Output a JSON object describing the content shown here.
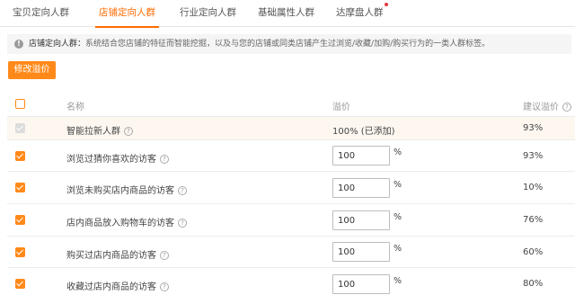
{
  "tabs": [
    {
      "label": "宝贝定向人群",
      "active": false
    },
    {
      "label": "店铺定向人群",
      "active": true
    },
    {
      "label": "行业定向人群",
      "active": false
    },
    {
      "label": "基础属性人群",
      "active": false
    },
    {
      "label": "达摩盘人群",
      "active": false,
      "badge_dot": true
    }
  ],
  "info": {
    "icon": "info-icon",
    "title": "店铺定向人群：",
    "text": "系统结合您店铺的特征而智能挖掘，以及与您的店铺或同类店铺产生过浏览/收藏/加购/购买行为的一类人群标签。"
  },
  "modify_button": {
    "label": "修改溢价"
  },
  "table": {
    "columns": {
      "name": "名称",
      "premium": "溢价",
      "suggested": "建议溢价"
    },
    "header_help_icon": "question-circle-icon",
    "rows": [
      {
        "name": "智能拉新人群",
        "checked": true,
        "disabled": true,
        "premium_text": "100% (已添加)",
        "suggested": "93%"
      },
      {
        "name": "浏览过猜你喜欢的访客",
        "checked": true,
        "disabled": false,
        "premium": "100",
        "unit": "%",
        "suggested": "93%"
      },
      {
        "name": "浏览未购买店内商品的访客",
        "checked": true,
        "disabled": false,
        "premium": "100",
        "unit": "%",
        "suggested": "10%"
      },
      {
        "name": "店内商品放入购物车的访客",
        "checked": true,
        "disabled": false,
        "premium": "100",
        "unit": "%",
        "suggested": "76%"
      },
      {
        "name": "购买过店内商品的访客",
        "checked": true,
        "disabled": false,
        "premium": "100",
        "unit": "%",
        "suggested": "60%"
      },
      {
        "name": "收藏过店内商品的访客",
        "checked": true,
        "disabled": false,
        "premium": "100",
        "unit": "%",
        "suggested": "80%"
      }
    ]
  },
  "colors": {
    "accent": "#ff6a00",
    "button": "#ff8a1a",
    "badge": "#e4393c"
  }
}
